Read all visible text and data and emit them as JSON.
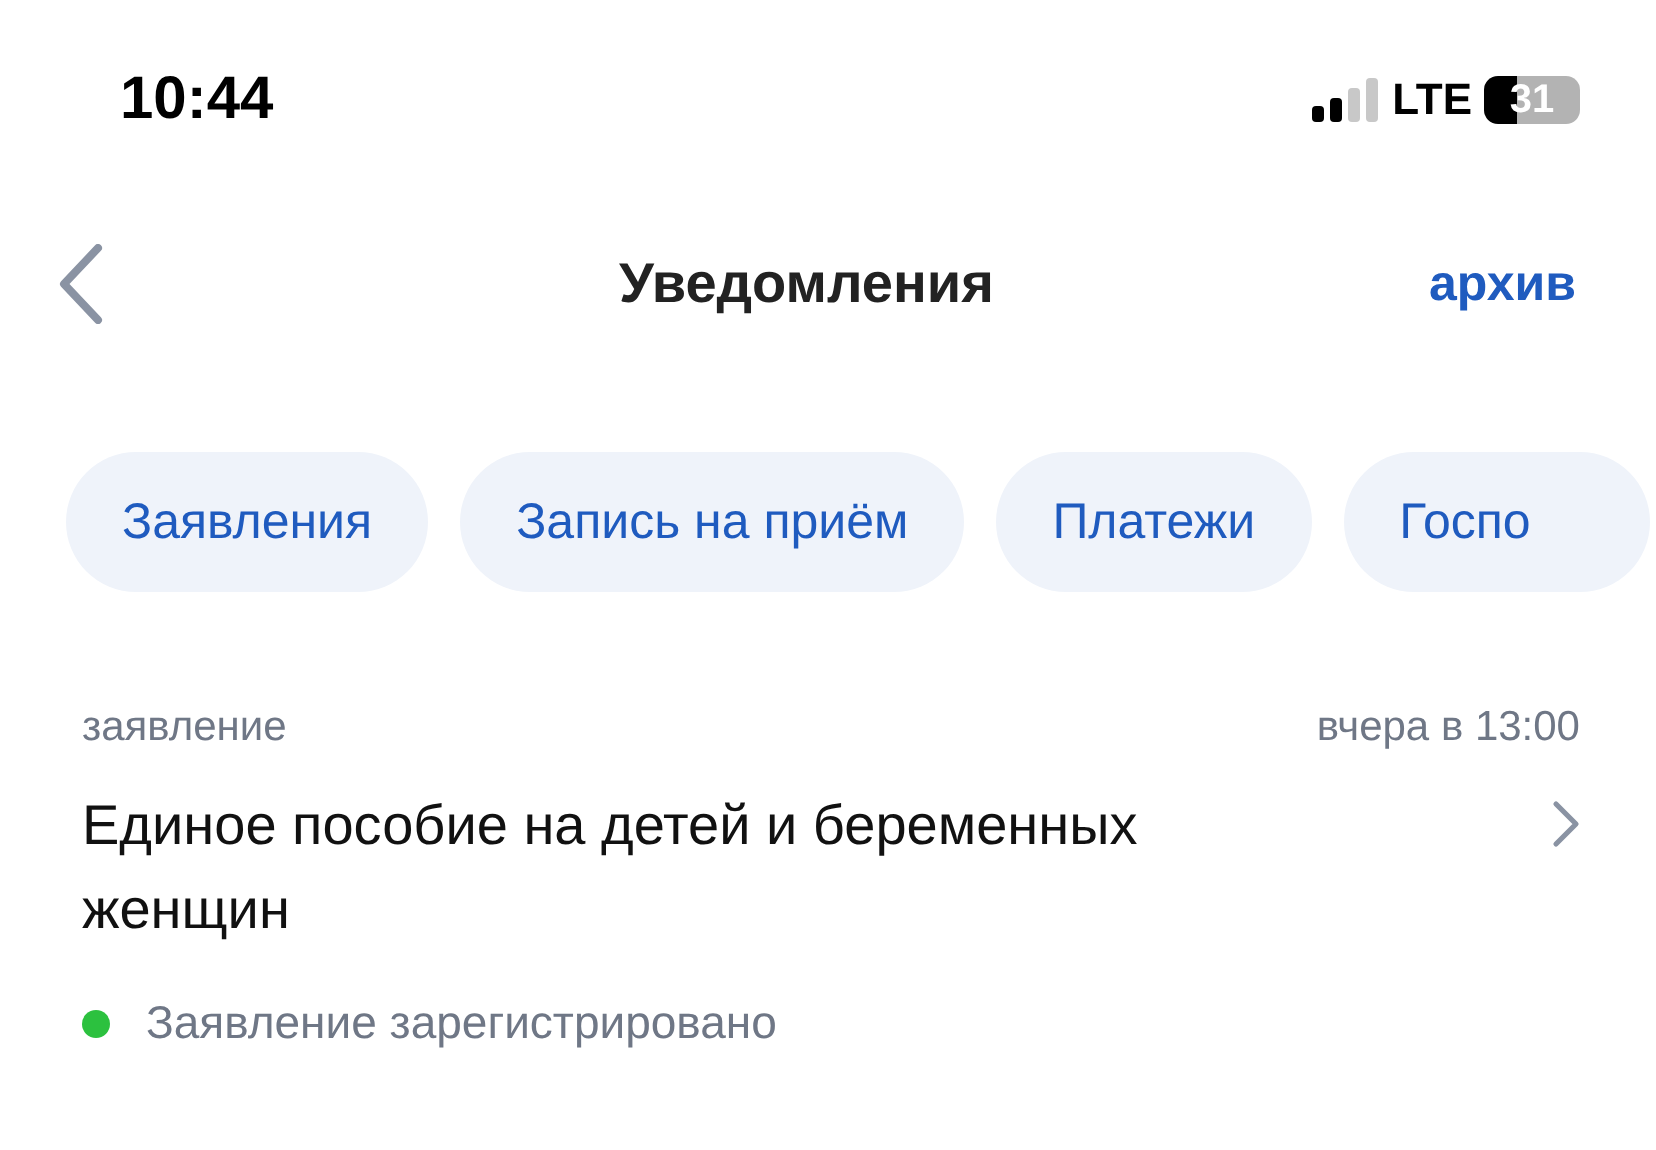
{
  "status_bar": {
    "time": "10:44",
    "network": "LTE",
    "battery": "31"
  },
  "nav": {
    "title": "Уведомления",
    "action": "архив"
  },
  "filters": [
    "Заявления",
    "Запись на приём",
    "Платежи",
    "Госпо"
  ],
  "notifications": [
    {
      "category": "заявление",
      "time": "вчера в 13:00",
      "title": "Единое пособие на детей и беременных женщин",
      "status": "Заявление зарегистрировано",
      "color": "#2cc13f"
    }
  ]
}
